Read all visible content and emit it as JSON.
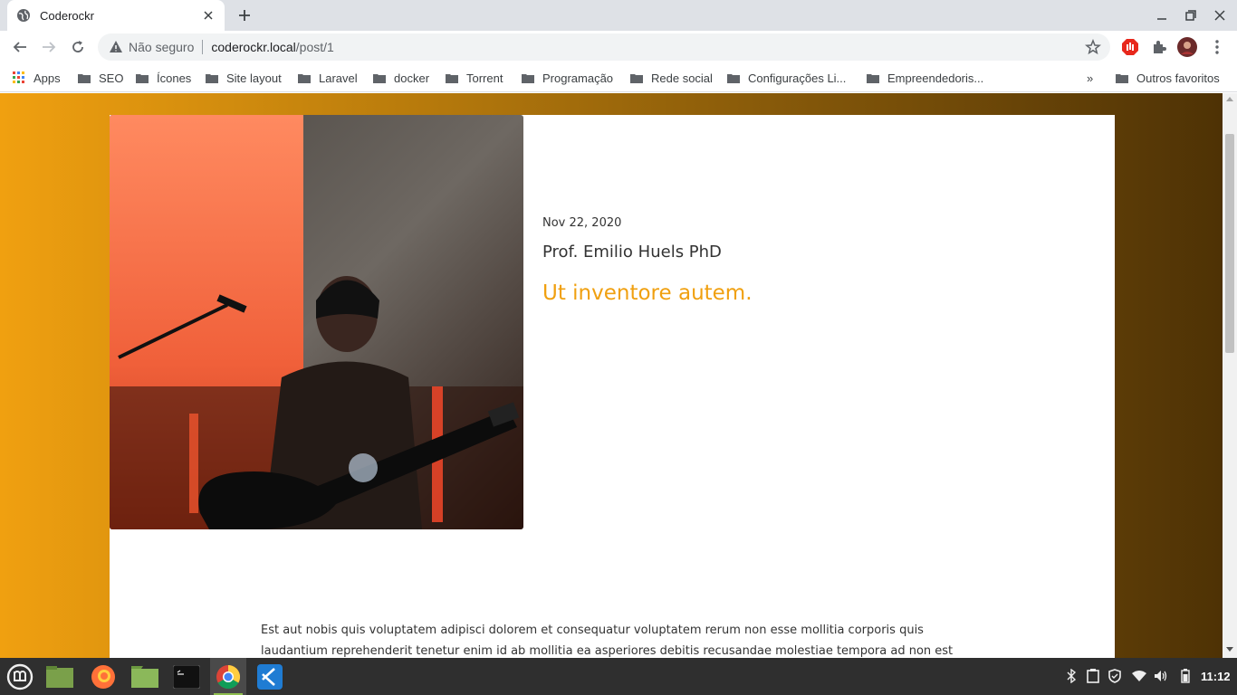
{
  "browser": {
    "tab_title": "Coderockr",
    "security_label": "Não seguro",
    "url_host": "coderockr.local",
    "url_path": "/post/1"
  },
  "bookmarks": {
    "apps_label": "Apps",
    "items": [
      "SEO",
      "Ícones",
      "Site layout",
      "Laravel",
      "docker",
      "Torrent",
      "Programação",
      "Rede social",
      "Configurações Li...",
      "Empreendedoris..."
    ],
    "overflow_label": "»",
    "other_label": "Outros favoritos"
  },
  "post": {
    "date": "Nov 22, 2020",
    "author": "Prof. Emilio Huels PhD",
    "title": "Ut inventore autem.",
    "body": "Est aut nobis quis voluptatem adipisci dolorem et consequatur voluptatem rerum non esse mollitia corporis quis laudantium reprehenderit tenetur enim id ab mollitia ea asperiores debitis recusandae molestiae tempora ad non est aut",
    "accent_color": "#f0a010"
  },
  "taskbar": {
    "apps": [
      "mint-menu",
      "files",
      "firefox",
      "folder",
      "terminal",
      "chrome",
      "vscode"
    ],
    "clock": "11:12"
  }
}
